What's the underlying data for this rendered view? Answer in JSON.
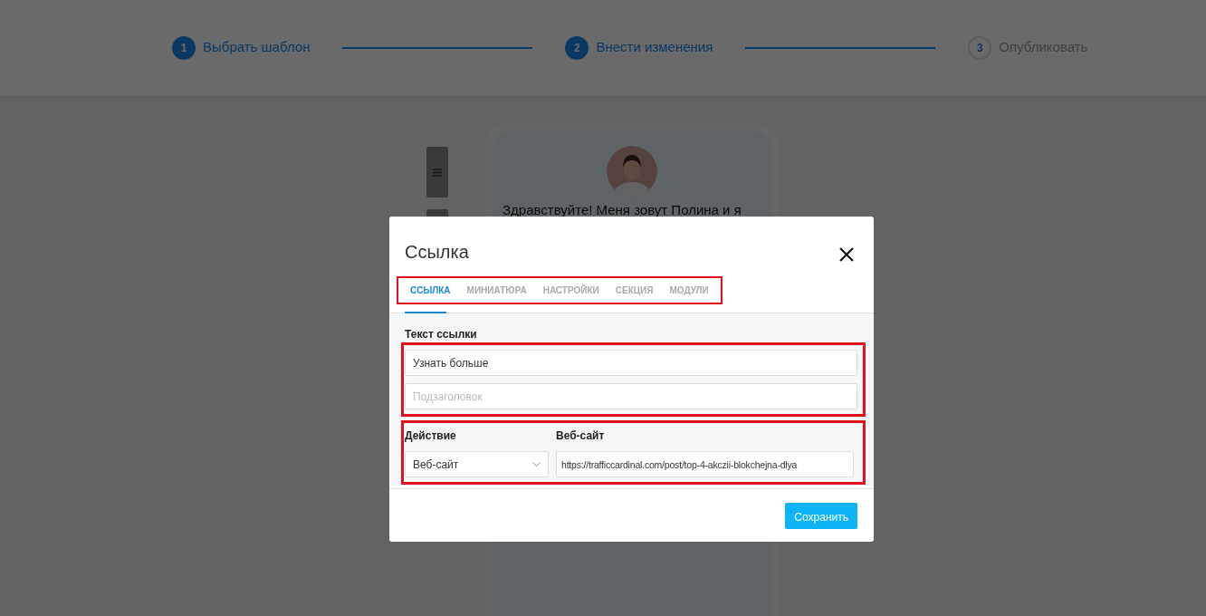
{
  "steps": [
    {
      "number": "1",
      "label": "Выбрать шаблон",
      "active": true
    },
    {
      "number": "2",
      "label": "Внести изменения",
      "active": true
    },
    {
      "number": "3",
      "label": "Опубликовать",
      "active": false
    }
  ],
  "editor": {
    "greeting": "Здравствуйте! Меня зовут Полина и я"
  },
  "modal": {
    "title": "Ссылка",
    "tabs": {
      "highlighted": true,
      "items": [
        {
          "label": "ССЫЛКА",
          "selected": true
        },
        {
          "label": "МИНИАТЮРА",
          "selected": false
        },
        {
          "label": "НАСТРОЙКИ",
          "selected": false
        },
        {
          "label": "СЕКЦИЯ",
          "selected": false
        },
        {
          "label": "МОДУЛИ",
          "selected": false
        }
      ]
    },
    "link_text": {
      "label": "Текст ссылки",
      "highlighted": true,
      "value": "Узнать больше",
      "subtitle_placeholder": "Подзаголовок"
    },
    "action": {
      "highlighted": true,
      "label": "Действие",
      "value": "Веб-сайт",
      "website_label": "Веб-сайт",
      "website_value": "https://trafficcardinal.com/post/top-4-akczii-blokchejna-dlya"
    },
    "save_button": "Сохранить"
  }
}
